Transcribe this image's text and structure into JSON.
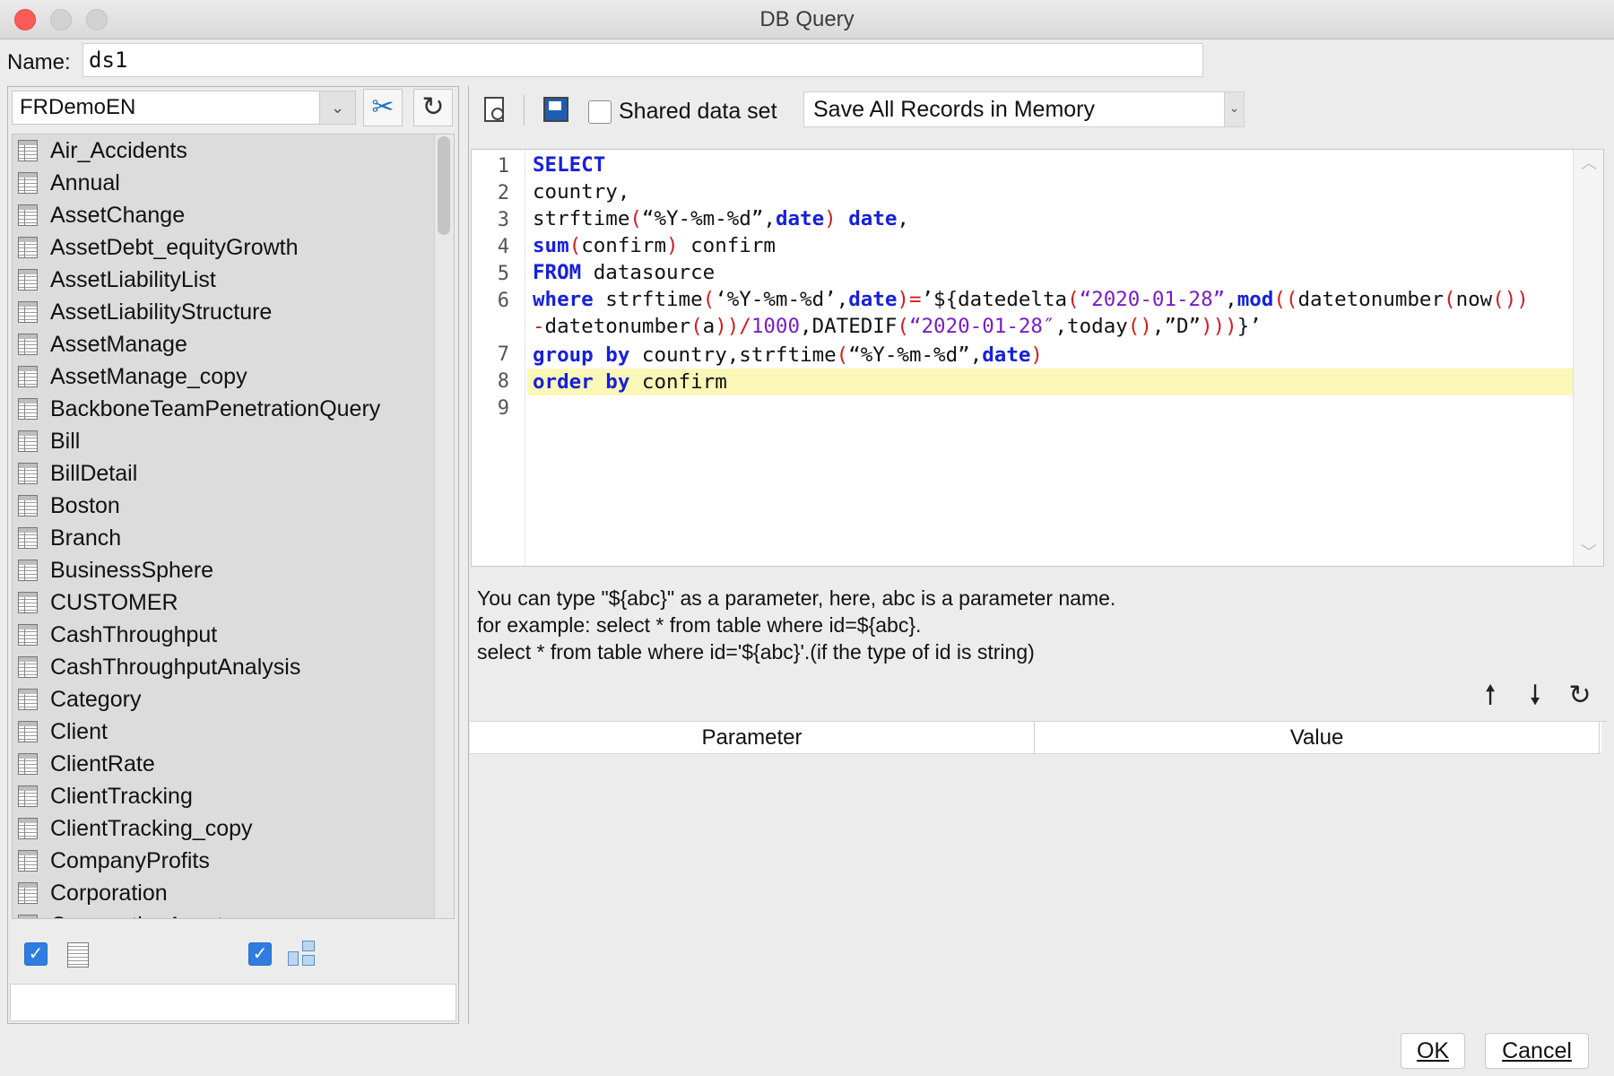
{
  "window": {
    "title": "DB Query"
  },
  "name_row": {
    "label": "Name:",
    "value": "ds1"
  },
  "left_panel": {
    "datasource": "FRDemoEN",
    "tables": [
      "Air_Accidents",
      "Annual",
      "AssetChange",
      "AssetDebt_equityGrowth",
      "AssetLiabilityList",
      "AssetLiabilityStructure",
      "AssetManage",
      "AssetManage_copy",
      "BackboneTeamPenetrationQuery",
      "Bill",
      "BillDetail",
      "Boston",
      "Branch",
      "BusinessSphere",
      "CUSTOMER",
      "CashThroughput",
      "CashThroughputAnalysis",
      "Category",
      "Client",
      "ClientRate",
      "ClientTracking",
      "ClientTracking_copy",
      "CompanyProfits",
      "Corporation",
      "CorporationAsset"
    ]
  },
  "toolbar": {
    "shared_label": "Shared data set",
    "memory_option": "Save All Records in Memory"
  },
  "editor": {
    "line_numbers": [
      "1",
      "2",
      "3",
      "4",
      "5",
      "6",
      "7",
      "8",
      "9"
    ],
    "code": {
      "l1_kw": "SELECT",
      "l2": "country,",
      "l3_a": "strftime",
      "l3_b": "(",
      "l3_c": "“%Y-%m-%d”",
      "l3_d": ",",
      "l3_e": "date",
      "l3_f": ")",
      "l3_g": " ",
      "l3_h": "date",
      "l3_i": ",",
      "l4_a": "sum",
      "l4_b": "(",
      "l4_c": "confirm",
      "l4_d": ")",
      "l4_e": " confirm",
      "l5_a": "FROM",
      "l5_b": " datasource",
      "l6_a": "where",
      "l6_b": " strftime",
      "l6_c": "(",
      "l6_d": "‘%Y-%m-%d’,",
      "l6_e": "date",
      "l6_f": ")=",
      "l6_g": "’${datedelta",
      "l6_h": "(",
      "l6_i": "“2020-01-28”",
      "l6_j": ",",
      "l6_k": "mod",
      "l6_l": "((",
      "l6_m": "datetonumber",
      "l6_n": "(",
      "l6_o": "now",
      "l6_p": "())",
      "l6w_a": "-",
      "l6w_b": "datetonumber",
      "l6w_c": "(",
      "l6w_d": "a",
      "l6w_e": "))/",
      "l6w_f": "1000",
      "l6w_g": ",DATEDIF",
      "l6w_h": "(",
      "l6w_i": "“2020-01-28″",
      "l6w_j": ",today",
      "l6w_k": "()",
      "l6w_l": ",”D”",
      "l6w_m": ")))",
      "l6w_n": "}’",
      "l7_a": "group",
      "l7_b": " ",
      "l7_c": "by",
      "l7_d": " country,strftime",
      "l7_e": "(",
      "l7_f": "“%Y-%m-%d”",
      "l7_g": ",",
      "l7_h": "date",
      "l7_i": ")",
      "l8_a": "order",
      "l8_b": " ",
      "l8_c": "by",
      "l8_d": " confirm"
    }
  },
  "hints": {
    "line1": "You can type \"${abc}\" as a parameter, here, abc is a parameter name.",
    "line2": "for example: select * from table where id=${abc}.",
    "line3": "select * from table where id='${abc}'.(if the type of id is string)"
  },
  "param_table": {
    "col_param": "Parameter",
    "col_value": "Value"
  },
  "buttons": {
    "ok": "OK",
    "cancel": "Cancel"
  },
  "colors": {
    "keyword": "#1720d9",
    "string": "#7a1cc7",
    "paren": "#d41b1b",
    "current_line": "#fbf7b8",
    "checkbox": "#2f7de1",
    "close": "#fc5b57"
  },
  "icons": {
    "connect": "wrench-screwdriver-icon",
    "refresh": "refresh-icon",
    "preview": "preview-icon",
    "save": "save-icon",
    "up": "arrow-up-icon",
    "down": "arrow-down-icon"
  }
}
